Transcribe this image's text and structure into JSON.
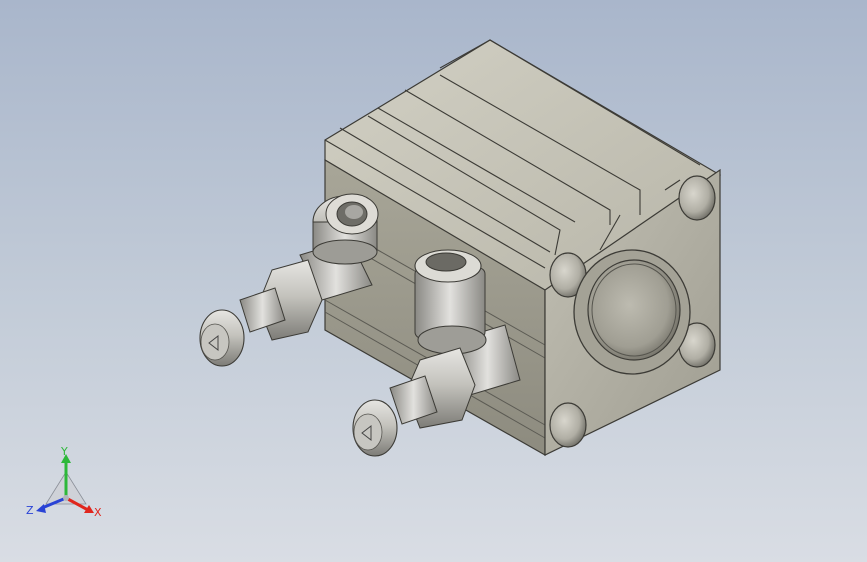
{
  "viewport": {
    "description_kind": "cad-3d-view",
    "background_top": "#a9b6cb",
    "background_bottom": "#d9dde4"
  },
  "model": {
    "body_color": "#b4b2a4",
    "fitting_color": "#c9c7c0"
  },
  "triad": {
    "x_label": "X",
    "y_label": "Y",
    "z_label": "Z",
    "x_color": "#e0261d",
    "y_color": "#2db83a",
    "z_color": "#2943d6"
  }
}
